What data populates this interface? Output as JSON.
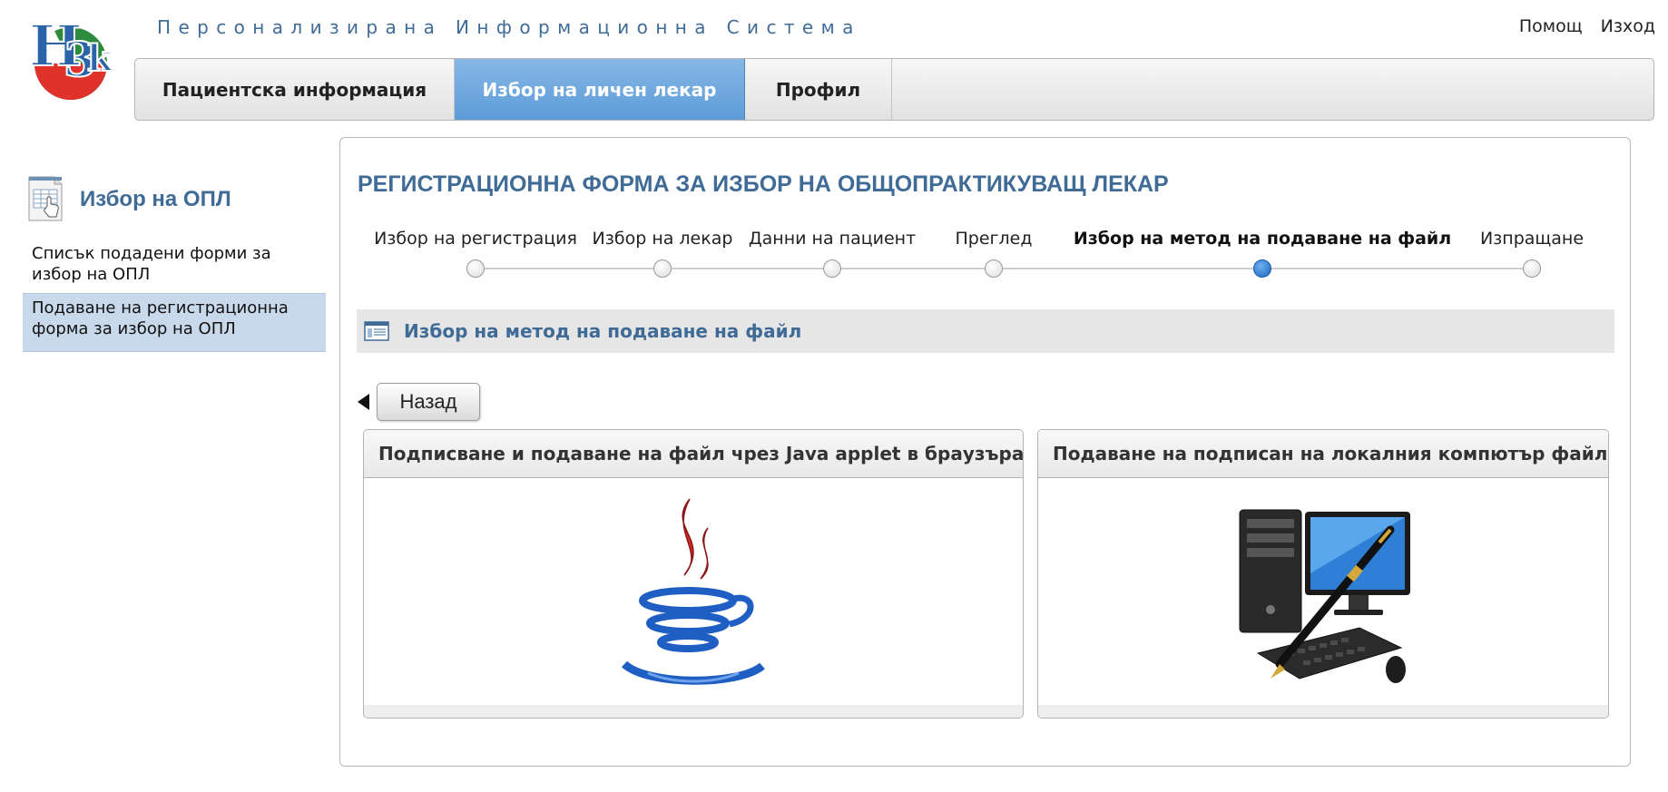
{
  "header": {
    "logo_text": "НЗОК",
    "app_title": "Персонализирана Информационна Система",
    "links": {
      "help": "Помощ",
      "logout": "Изход"
    }
  },
  "nav": {
    "tabs": [
      {
        "label": "Пациентска информация",
        "active": false
      },
      {
        "label": "Избор на личен лекар",
        "active": true
      },
      {
        "label": "Профил",
        "active": false
      }
    ]
  },
  "sidebar": {
    "title": "Избор на ОПЛ",
    "items": [
      {
        "label": "Списък подадени форми за избор на ОПЛ",
        "active": false
      },
      {
        "label": "Подаване на регистрационна форма за избор на ОПЛ",
        "active": true
      }
    ]
  },
  "main": {
    "form_title": "РЕГИСТРАЦИОННА ФОРМА ЗА ИЗБОР НА ОБЩОПРАКТИКУВАЩ ЛЕКАР",
    "steps": [
      {
        "label": "Избор на регистрация",
        "active": false
      },
      {
        "label": "Избор на лекар",
        "active": false
      },
      {
        "label": "Данни на пациент",
        "active": false
      },
      {
        "label": "Преглед",
        "active": false
      },
      {
        "label": "Избор на метод на подаване на файл",
        "active": true
      },
      {
        "label": "Изпращане",
        "active": false
      }
    ],
    "section_title": "Избор на метод на подаване на файл",
    "back_button": "Назад",
    "options": [
      {
        "title": "Подписване и подаване на файл чрез Java applet в браузъра",
        "image": "java-logo-icon"
      },
      {
        "title": "Подаване на подписан на локалния компютър файл",
        "image": "computer-pen-icon"
      }
    ]
  },
  "colors": {
    "accent_blue": "#3f6b96",
    "active_tab": "#5d9cd8",
    "sidebar_active": "#c9d9ec",
    "step_active": "#1a66c2"
  }
}
